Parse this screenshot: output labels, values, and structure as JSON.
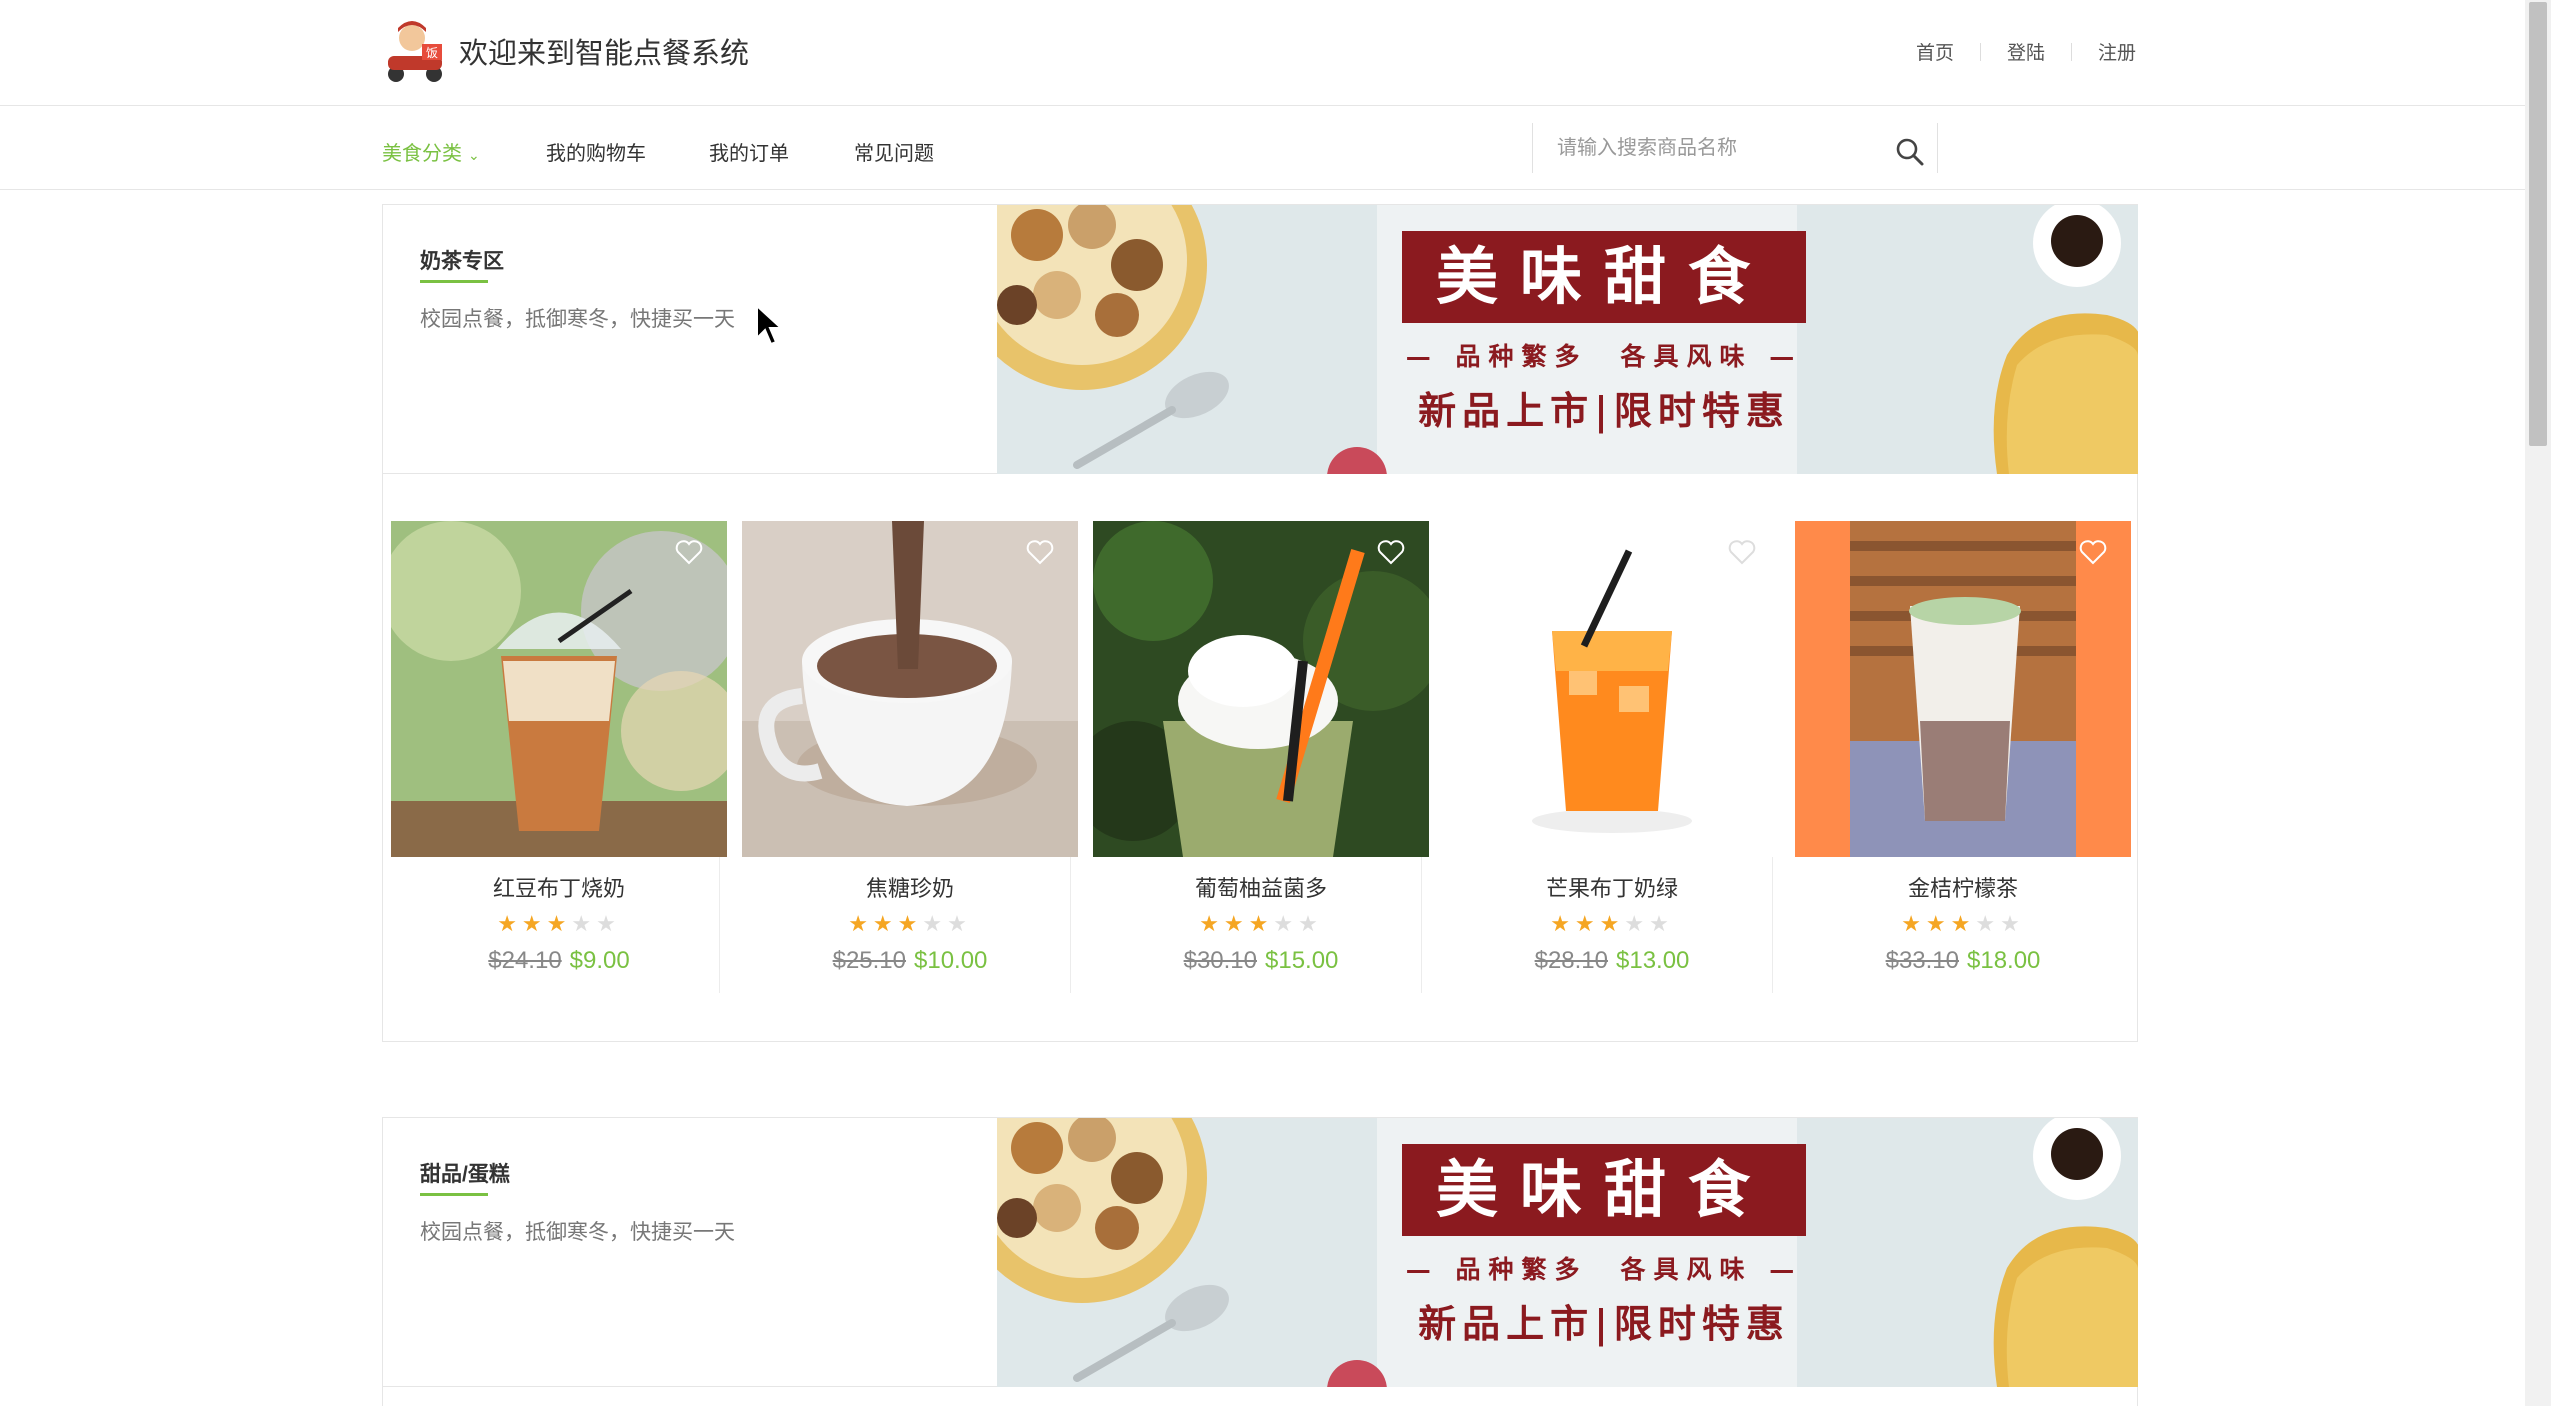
{
  "header": {
    "site_title": "欢迎来到智能点餐系统",
    "links": [
      "首页",
      "登陆",
      "注册"
    ]
  },
  "nav": {
    "items": [
      "美食分类",
      "我的购物车",
      "我的订单",
      "常见问题"
    ],
    "caret": "⌄",
    "search_placeholder": "请输入搜索商品名称"
  },
  "sections": [
    {
      "title": "奶茶专区",
      "desc": "校园点餐，抵御寒冬，快捷买一天",
      "banner": {
        "headline": "美味甜食",
        "sub": "— 品种繁多　各具风味 —",
        "tagline": "新品上市|限时特惠"
      },
      "products": [
        {
          "name": "红豆布丁烧奶",
          "old_price": "$24.10",
          "price": "$9.00",
          "rating": 3,
          "max_rating": 5
        },
        {
          "name": "焦糖珍奶",
          "old_price": "$25.10",
          "price": "$10.00",
          "rating": 3,
          "max_rating": 5
        },
        {
          "name": "葡萄柚益菌多",
          "old_price": "$30.10",
          "price": "$15.00",
          "rating": 3,
          "max_rating": 5
        },
        {
          "name": "芒果布丁奶绿",
          "old_price": "$28.10",
          "price": "$13.00",
          "rating": 3,
          "max_rating": 5
        },
        {
          "name": "金桔柠檬茶",
          "old_price": "$33.10",
          "price": "$18.00",
          "rating": 3,
          "max_rating": 5
        }
      ]
    },
    {
      "title": "甜品/蛋糕",
      "desc": "校园点餐，抵御寒冬，快捷买一天",
      "banner": {
        "headline": "美味甜食",
        "sub": "— 品种繁多　各具风味 —",
        "tagline": "新品上市|限时特惠"
      }
    }
  ],
  "colors": {
    "accent": "#7ac142",
    "star_on": "#f5a623",
    "star_off": "#dddddd",
    "banner_red": "#8b1a1f"
  },
  "icons": [
    "logo",
    "chevron-down-icon",
    "search-icon",
    "heart-icon",
    "star-icon",
    "mouse-cursor"
  ]
}
